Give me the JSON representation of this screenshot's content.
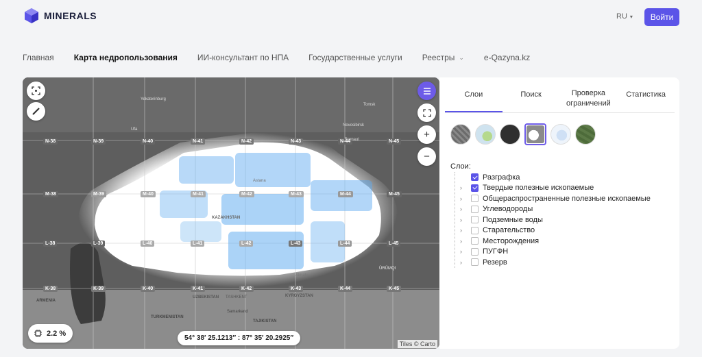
{
  "header": {
    "brand": "MINERALS",
    "language": "RU",
    "login_label": "Войти"
  },
  "nav": {
    "items": [
      {
        "label": "Главная",
        "active": false
      },
      {
        "label": "Карта недропользования",
        "active": true
      },
      {
        "label": "ИИ-консультант по НПА",
        "active": false
      },
      {
        "label": "Государственные услуги",
        "active": false
      },
      {
        "label": "Реестры",
        "active": false,
        "has_dropdown": true
      },
      {
        "label": "e-Qazyna.kz",
        "active": false
      }
    ]
  },
  "map": {
    "zoom_level": "2.2 %",
    "coordinates": "54° 38′ 25.1213″ : 87° 35′ 20.2925″",
    "attribution": "Tiles © Carto",
    "grid_labels": [
      "N-38",
      "N-39",
      "N-40",
      "N-41",
      "N-42",
      "N-43",
      "N-44",
      "N-45",
      "M-38",
      "M-39",
      "M-40",
      "M-41",
      "M-42",
      "M-43",
      "M-44",
      "M-45",
      "L-38",
      "L-39",
      "L-40",
      "L-41",
      "L-42",
      "L-43",
      "L-44",
      "L-45",
      "K-38",
      "K-39",
      "K-40",
      "K-41",
      "K-42",
      "K-43",
      "K-44",
      "K-45"
    ],
    "place_labels": [
      "Yekaterinburg",
      "Ufa",
      "Tomsk",
      "Novosibirsk",
      "Barnaul",
      "Astana",
      "KAZAKHSTAN",
      "Almaty",
      "UZBEKISTAN",
      "TASHKENT",
      "KYRGYZSTAN",
      "TURKMENISTAN",
      "TAJIKISTAN",
      "ARMENIA",
      "Samarkand",
      "ÜRÜMQI"
    ],
    "buttons": {
      "menu_icon": "menu-icon",
      "fullscreen_icon": "expand-icon",
      "zoom_in": "+",
      "zoom_out": "−"
    }
  },
  "panel": {
    "tabs": [
      {
        "label": "Слои",
        "active": true
      },
      {
        "label": "Поиск",
        "active": false
      },
      {
        "label": "Проверка ограничений",
        "active": false
      },
      {
        "label": "Статистика",
        "active": false
      }
    ],
    "basemaps": [
      {
        "name": "satellite-gray",
        "color": "#7a7a7a"
      },
      {
        "name": "light-terrain",
        "color": "#cfe3ef"
      },
      {
        "name": "dark",
        "color": "#2f2f2f"
      },
      {
        "name": "gray-selected",
        "color": "#8b8b8b",
        "selected": true
      },
      {
        "name": "light-blue",
        "color": "#e3eef8"
      },
      {
        "name": "topo-green",
        "color": "#4d6b3a"
      }
    ],
    "layers_title": "Слои:",
    "layers": [
      {
        "label": "Разграфка",
        "checked": true,
        "expandable": false
      },
      {
        "label": "Твердые полезные ископаемые",
        "checked": true,
        "expandable": true
      },
      {
        "label": "Общераспространенные полезные ископаемые",
        "checked": false,
        "expandable": true
      },
      {
        "label": "Углеводороды",
        "checked": false,
        "expandable": true
      },
      {
        "label": "Подземные воды",
        "checked": false,
        "expandable": true
      },
      {
        "label": "Старательство",
        "checked": false,
        "expandable": true
      },
      {
        "label": "Месторождения",
        "checked": false,
        "expandable": true
      },
      {
        "label": "ПУГФН",
        "checked": false,
        "expandable": true
      },
      {
        "label": "Резерв",
        "checked": false,
        "expandable": true
      }
    ]
  },
  "colors": {
    "accent": "#5b54e8",
    "deposits": "#5aa8ef"
  }
}
